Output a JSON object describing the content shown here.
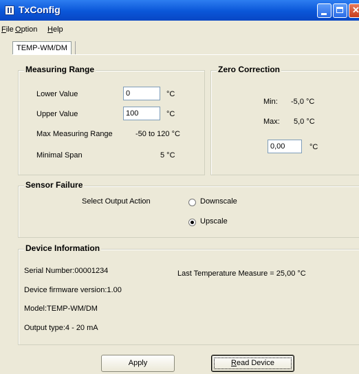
{
  "window": {
    "title": "TxConfig"
  },
  "menu": [
    {
      "prefix": "",
      "mnemonic": "F",
      "rest": "ile"
    },
    {
      "prefix": "",
      "mnemonic": "O",
      "rest": "ption"
    },
    {
      "prefix": "",
      "mnemonic": "H",
      "rest": "elp"
    }
  ],
  "tab": {
    "label": "TEMP-WM/DM"
  },
  "measuring": {
    "title": "Measuring Range",
    "lower_label": "Lower Value",
    "lower_value": "0",
    "upper_label": "Upper Value",
    "upper_value": "100",
    "unit": "°C",
    "max_range_label": "Max Measuring Range",
    "max_range_value": "-50 to 120 °C",
    "min_span_label": "Minimal Span",
    "min_span_value": "5 °C"
  },
  "zero": {
    "title": "Zero Correction",
    "min_label": "Min:",
    "min_value": "-5,0 °C",
    "max_label": "Max:",
    "max_value": "5,0 °C",
    "value": "0,00",
    "unit": "°C"
  },
  "sensor": {
    "title": "Sensor Failure",
    "prompt": "Select Output Action",
    "options": [
      "Downscale",
      "Upscale"
    ],
    "selected": "Upscale"
  },
  "device": {
    "title": "Device Information",
    "serial": "Serial Number:00001234",
    "firmware": "Device firmware version:1.00",
    "model": "Model:TEMP-WM/DM",
    "output": "Output type:4 - 20 mA",
    "last_temp": "Last Temperature Measure = 25,00 °C"
  },
  "buttons": {
    "apply": "Apply",
    "read_mnemonic": "R",
    "read_rest": "ead Device"
  }
}
